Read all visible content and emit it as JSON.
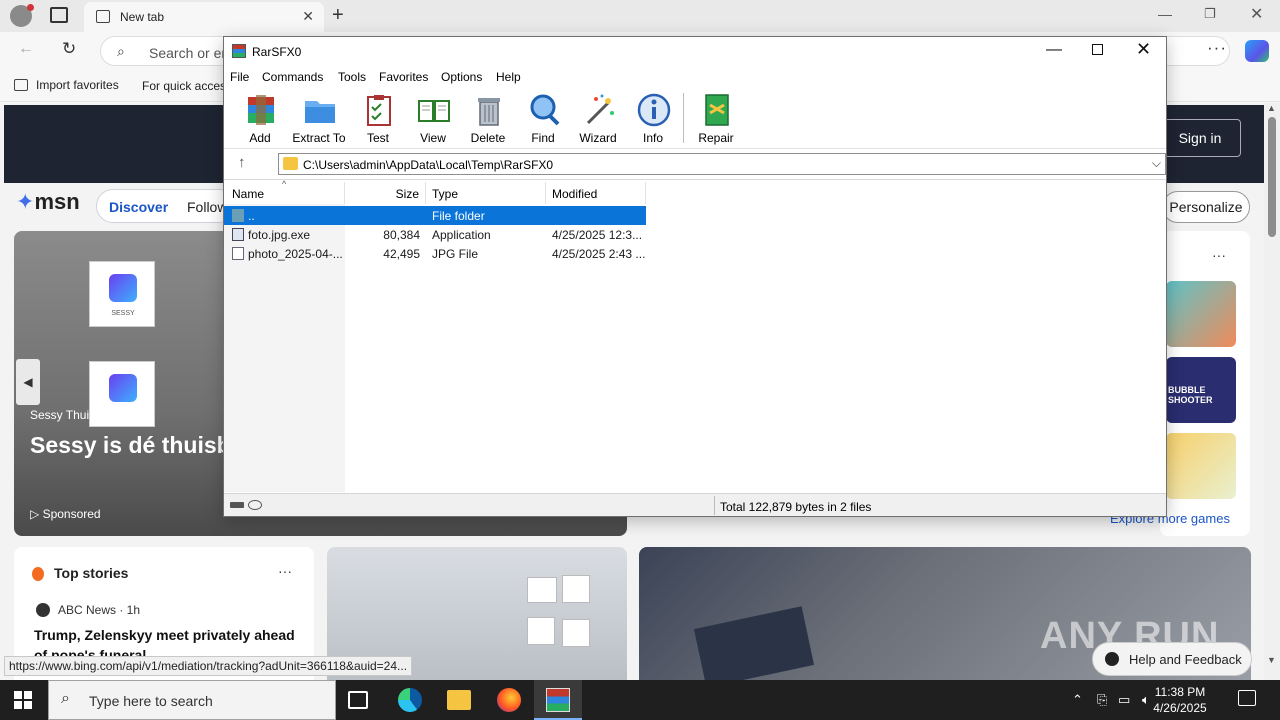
{
  "browser": {
    "tab_title": "New tab",
    "address_placeholder": "Search or enter web address",
    "address_visible": "Search or er",
    "favorites": {
      "import_label": "Import favorites",
      "quick_label": "For quick acces"
    },
    "status_url": "https://www.bing.com/api/v1/mediation/tracking?adUnit=366118&auid=24..."
  },
  "msn": {
    "logo": "msn",
    "nav_discover": "Discover",
    "nav_following": "Follow",
    "sign_in": "Sign in",
    "personalize": "Personalize",
    "hero_card": {
      "brand_tile_text": "SESSY",
      "sponsor_name": "Sessy Thuisbatterij",
      "headline": "Sessy is dé thuisba particulieren. In N",
      "sponsored_label": "Sponsored"
    },
    "games": {
      "tile_text": "BUBBLE SHOOTER",
      "explore_label": "Explore more games"
    },
    "top_stories": {
      "title": "Top stories",
      "source": "ABC News · 1h",
      "headline": "Trump, Zelenskyy meet privately ahead of pope's funeral"
    },
    "help_feedback": "Help and Feedback",
    "watermark": "ANY RUN"
  },
  "winrar": {
    "title": "RarSFX0",
    "menu": [
      "File",
      "Commands",
      "Tools",
      "Favorites",
      "Options",
      "Help"
    ],
    "toolbar": [
      {
        "label": "Add",
        "icon": "add-archive-icon"
      },
      {
        "label": "Extract To",
        "icon": "extract-folder-icon"
      },
      {
        "label": "Test",
        "icon": "test-clipboard-icon"
      },
      {
        "label": "View",
        "icon": "view-book-icon"
      },
      {
        "label": "Delete",
        "icon": "trash-icon"
      },
      {
        "label": "Find",
        "icon": "magnifier-icon"
      },
      {
        "label": "Wizard",
        "icon": "wizard-wand-icon"
      },
      {
        "label": "Info",
        "icon": "info-icon"
      },
      {
        "label": "Repair",
        "icon": "repair-book-icon"
      }
    ],
    "path": "C:\\Users\\admin\\AppData\\Local\\Temp\\RarSFX0",
    "columns": [
      "Name",
      "Size",
      "Type",
      "Modified"
    ],
    "rows": [
      {
        "name": "..",
        "size": "",
        "type": "File folder",
        "modified": ""
      },
      {
        "name": "foto.jpg.exe",
        "size": "80,384",
        "type": "Application",
        "modified": "4/25/2025 12:3..."
      },
      {
        "name": "photo_2025-04-...",
        "size": "42,495",
        "type": "JPG File",
        "modified": "4/25/2025 2:43 ..."
      }
    ],
    "status": "Total 122,879 bytes in 2 files"
  },
  "taskbar": {
    "search_placeholder": "Type here to search",
    "time": "11:38 PM",
    "date": "4/26/2025"
  },
  "colors": {
    "selection": "#0a74d8",
    "taskbar": "#1f1f1f",
    "msn_accent": "#1a56c7"
  }
}
